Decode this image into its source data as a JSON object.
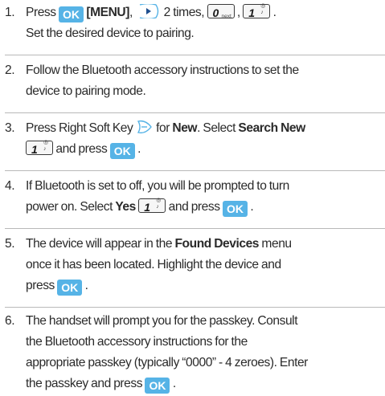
{
  "steps": [
    {
      "number": "1.",
      "line1": {
        "t1": "Press ",
        "ok": "OK",
        "menu": "[MENU]",
        "t2": ", ",
        "t3": " 2 times, ",
        "key0_digit": "0",
        "key0_sub": "next",
        "t4": " , ",
        "key1_digit": "1",
        "t5": " ."
      },
      "line2": "Set the desired device to pairing."
    },
    {
      "number": "2.",
      "line1": "Follow the Bluetooth accessory instructions to set the",
      "line2": "device to pairing mode."
    },
    {
      "number": "3.",
      "line1": {
        "t1": "Press Right Soft Key ",
        "t2": " for ",
        "new": "New",
        "t3": ". Select ",
        "search": "Search New"
      },
      "line2": {
        "key1_digit": "1",
        "t1": " and press ",
        "ok": "OK",
        "t2": " ."
      }
    },
    {
      "number": "4.",
      "line1": "If Bluetooth is set to off, you will be prompted to turn",
      "line2": {
        "t1": "power on. Select ",
        "yes": "Yes",
        "key1_digit": "1",
        "t2": " and press ",
        "ok": "OK",
        "t3": " ."
      }
    },
    {
      "number": "5.",
      "line1": {
        "t1": "The device will appear in the ",
        "found": "Found Devices",
        "t2": " menu"
      },
      "line2": "once it has been located. Highlight the device and",
      "line3": {
        "t1": "press ",
        "ok": "OK",
        "t2": " ."
      }
    },
    {
      "number": "6.",
      "line1": "The handset will prompt you for the passkey. Consult",
      "line2": "the Bluetooth accessory instructions for the",
      "line3": "appropriate passkey (typically “0000” - 4 zeroes). Enter",
      "line4": {
        "t1": "the passkey and press ",
        "ok": "OK",
        "t2": " ."
      }
    }
  ],
  "colors": {
    "ok_key": "#56b3e6",
    "separator": "#b9b9b9",
    "text": "#2a2a2a"
  },
  "icons": [
    "ok-key",
    "nav-right-key",
    "zero-key",
    "one-key",
    "right-soft-key"
  ]
}
